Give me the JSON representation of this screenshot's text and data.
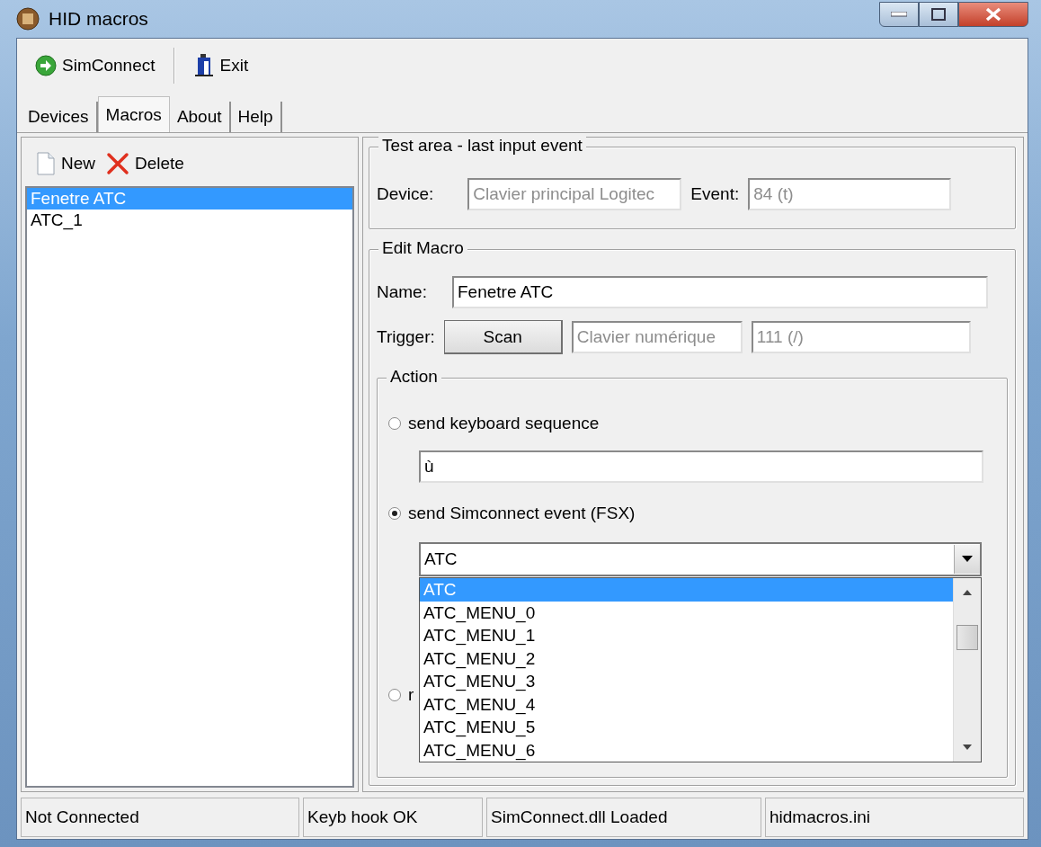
{
  "window": {
    "title": "HID macros"
  },
  "toolbar": [
    {
      "label": "SimConnect",
      "kind": "connect"
    },
    {
      "label": "Exit",
      "kind": "exit"
    }
  ],
  "tabs": [
    {
      "label": "Devices",
      "selected": false
    },
    {
      "label": "Macros",
      "selected": true
    },
    {
      "label": "About",
      "selected": false
    },
    {
      "label": "Help",
      "selected": false
    }
  ],
  "macro_toolbar": [
    {
      "label": "New",
      "kind": "new"
    },
    {
      "label": "Delete",
      "kind": "delete"
    }
  ],
  "macros": [
    {
      "label": "Fenetre ATC",
      "selected": true
    },
    {
      "label": "ATC_1",
      "selected": false
    }
  ],
  "test_area": {
    "title": "Test area - last input event",
    "device_label": "Device:",
    "device_value": "Clavier principal Logitec",
    "event_label": "Event:",
    "event_value": "84  (t)"
  },
  "edit_macro": {
    "title": "Edit Macro",
    "name_label": "Name:",
    "name_value": "Fenetre ATC",
    "trigger_label": "Trigger:",
    "scan_button": "Scan",
    "trigger_device": "Clavier numérique",
    "trigger_event": "111  (/)"
  },
  "action": {
    "title": "Action",
    "options": [
      {
        "label": "send keyboard sequence",
        "selected": false
      },
      {
        "label": "send Simconnect event (FSX)",
        "selected": true
      },
      {
        "label": "r",
        "selected": false
      }
    ],
    "keyboard_sequence": "ù",
    "event_combo": {
      "value": "ATC",
      "expanded": true,
      "options": [
        {
          "label": "ATC",
          "selected": true
        },
        {
          "label": "ATC_MENU_0",
          "selected": false
        },
        {
          "label": "ATC_MENU_1",
          "selected": false
        },
        {
          "label": "ATC_MENU_2",
          "selected": false
        },
        {
          "label": "ATC_MENU_3",
          "selected": false
        },
        {
          "label": "ATC_MENU_4",
          "selected": false
        },
        {
          "label": "ATC_MENU_5",
          "selected": false
        },
        {
          "label": "ATC_MENU_6",
          "selected": false
        }
      ]
    }
  },
  "status_bar": [
    "Not Connected",
    "Keyb hook OK",
    "SimConnect.dll Loaded",
    "hidmacros.ini"
  ]
}
